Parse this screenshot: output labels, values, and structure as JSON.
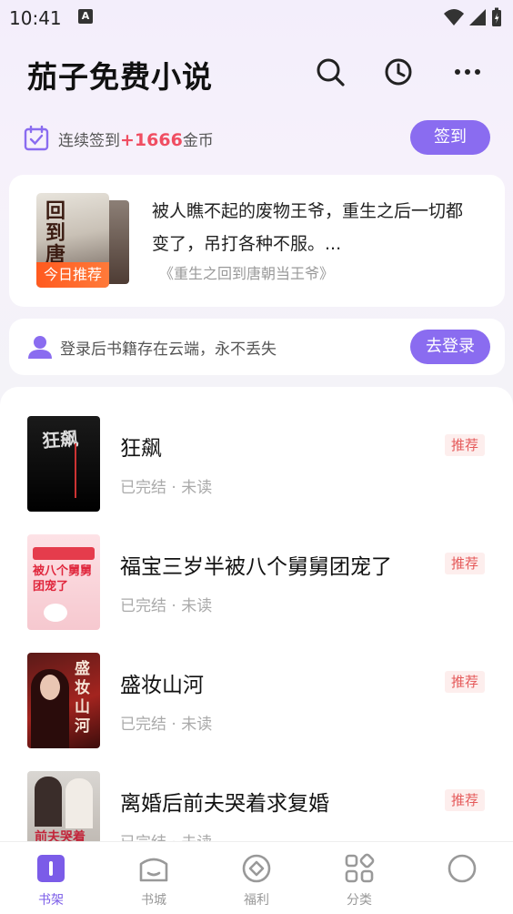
{
  "status_bar": {
    "time": "10:41",
    "notif_letter": "A"
  },
  "header": {
    "title": "茄子免费小说"
  },
  "checkin": {
    "prefix": "连续签到",
    "coins": "+1666",
    "suffix": "金币",
    "button": "签到"
  },
  "recommendation": {
    "badge": "今日推荐",
    "cover_title": "回到唐朝",
    "description": "被人瞧不起的废物王爷，重生之后一切都变了，吊打各种不服。...",
    "book": "《重生之回到唐朝当王爷》"
  },
  "login_banner": {
    "text": "登录后书籍存在云端，永不丢失",
    "button": "去登录"
  },
  "books": [
    {
      "title": "狂飙",
      "meta": "已完结 · 未读",
      "tag": "推荐",
      "cover_text": "狂飙"
    },
    {
      "title": "福宝三岁半被八个舅舅团宠了",
      "meta": "已完结 · 未读",
      "tag": "推荐",
      "cover_text": "被八个舅舅团宠了"
    },
    {
      "title": "盛妆山河",
      "meta": "已完结 · 未读",
      "tag": "推荐",
      "cover_text": "盛妆山河"
    },
    {
      "title": "离婚后前夫哭着求复婚",
      "meta": "已完结 · 未读",
      "tag": "推荐",
      "cover_text": "前夫哭着"
    }
  ],
  "nav": {
    "items": [
      {
        "label": "书架",
        "icon": "bookshelf-icon",
        "active": true
      },
      {
        "label": "书城",
        "icon": "bookstore-icon"
      },
      {
        "label": "福利",
        "icon": "welfare-icon"
      },
      {
        "label": "分类",
        "icon": "category-icon"
      },
      {
        "label": "",
        "icon": "profile-icon"
      }
    ]
  },
  "colors": {
    "accent": "#8a6cf0",
    "coin": "#f04e62",
    "badge": "#ff5a1f",
    "tag_bg": "#fdeeed",
    "tag_text": "#e55a5a"
  }
}
